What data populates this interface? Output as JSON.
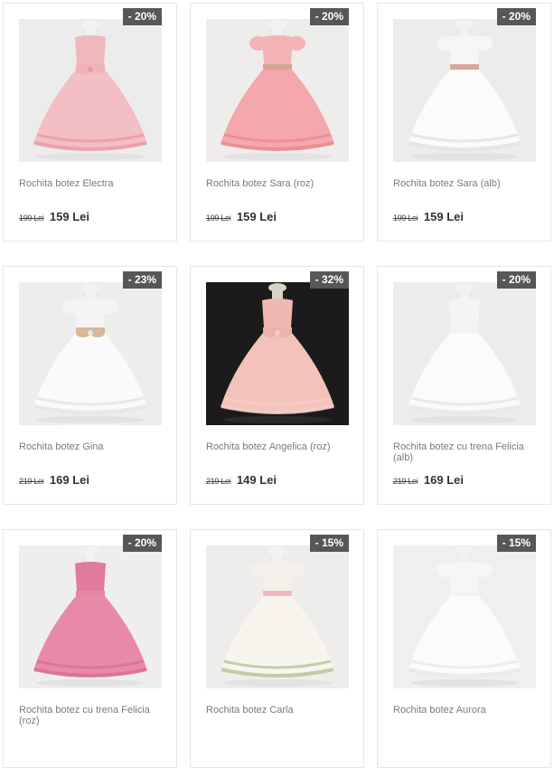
{
  "products": [
    {
      "name": "Rochita botez Electra",
      "discount": "- 20%",
      "old_price": "199 Lei",
      "price": "159 Lei",
      "icon": "pink-rosette-dress-image",
      "bg": "#ececed",
      "dark": false,
      "dress": "#f3bfc4",
      "top": "#f0b8bd",
      "belt": "#efb3b9",
      "bow": true,
      "hem": "#e89ca5",
      "sleeve": false
    },
    {
      "name": "Rochita botez Sara (roz)",
      "discount": "- 20%",
      "old_price": "199 Lei",
      "price": "159 Lei",
      "icon": "pink-sequin-belt-dress-image",
      "bg": "#eeedeb",
      "dark": false,
      "dress": "#f4a7ac",
      "top": "#f6b3b7",
      "belt": "#d4a58f",
      "bow": false,
      "hem": "#e9898f",
      "sleeve": true
    },
    {
      "name": "Rochita botez Sara (alb)",
      "discount": "- 20%",
      "old_price": "199 Lei",
      "price": "159 Lei",
      "icon": "white-sequin-belt-dress-image",
      "bg": "#ececec",
      "dark": false,
      "dress": "#fbfbfb",
      "top": "#f6f6f6",
      "belt": "#d9a69e",
      "bow": false,
      "hem": "#e2e2e6",
      "sleeve": true
    },
    {
      "name": "Rochita botez Gina",
      "discount": "- 23%",
      "old_price": "219 Lei",
      "price": "169 Lei",
      "icon": "white-gold-bow-dress-image",
      "bg": "#ededec",
      "dark": false,
      "dress": "#fafafa",
      "top": "#f4f4f4",
      "belt": "#d8b79a",
      "bow": true,
      "hem": "#e4e4e4",
      "sleeve": true
    },
    {
      "name": "Rochita botez Angelica (roz)",
      "discount": "- 32%",
      "old_price": "219 Lei",
      "price": "149 Lei",
      "icon": "pink-dress-dark-background-image",
      "bg": "#1c1b1b",
      "dark": true,
      "dress": "#f2c2bb",
      "top": "#eeb9b2",
      "belt": "#eab3ab",
      "bow": true,
      "hem": "#f5cdc7",
      "sleeve": false
    },
    {
      "name": "Rochita botez cu trena Felicia (alb)",
      "discount": "- 20%",
      "old_price": "219 Lei",
      "price": "169 Lei",
      "icon": "white-train-dress-image",
      "bg": "#ececec",
      "dark": false,
      "dress": "#fbfbfb",
      "top": "#f5f5f5",
      "belt": "#f2f2f2",
      "bow": false,
      "hem": "#e6e6e6",
      "sleeve": false
    },
    {
      "name": "Rochita botez cu trena Felicia (roz)",
      "discount": "- 20%",
      "old_price": "",
      "price": "",
      "icon": "pink-lace-train-dress-image",
      "bg": "#eeeeee",
      "dark": false,
      "dress": "#e889a7",
      "top": "#e07b9c",
      "belt": "#e785a3",
      "bow": false,
      "hem": "#d96f93",
      "sleeve": false
    },
    {
      "name": "Rochita botez Carla",
      "discount": "- 15%",
      "old_price": "",
      "price": "",
      "icon": "floral-embroidered-dress-image",
      "bg": "#eeedeb",
      "dark": false,
      "dress": "#f7f5ee",
      "top": "#f3f0ea",
      "belt": "#f3b9c0",
      "bow": false,
      "hem": "#b7c49a",
      "sleeve": true
    },
    {
      "name": "Rochita botez Aurora",
      "discount": "- 15%",
      "old_price": "",
      "price": "",
      "icon": "white-floral-dress-image",
      "bg": "#efefef",
      "dark": false,
      "dress": "#fbfbfb",
      "top": "#f6f6f6",
      "belt": "#f3f3f3",
      "bow": false,
      "hem": "#e8e8e8",
      "sleeve": true
    }
  ]
}
